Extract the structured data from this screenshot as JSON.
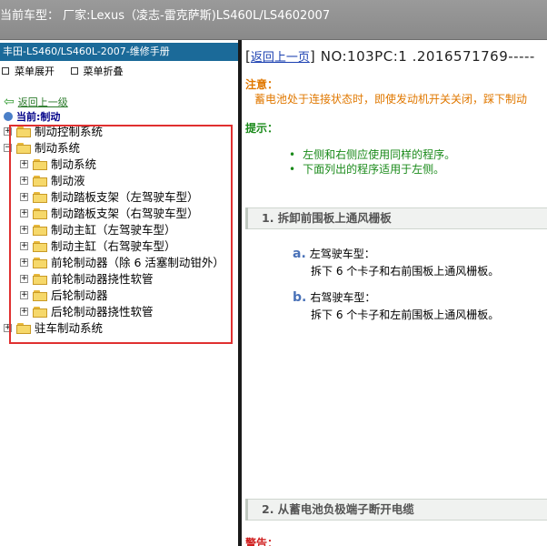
{
  "window": {
    "title": "当前车型： 厂家:Lexus（凌志-雷克萨斯)LS460L/LS4602007"
  },
  "left_panel": {
    "header": "丰田-LS460/LS460L-2007-维修手册",
    "menu_expand": "菜单展开",
    "menu_collapse": "菜单折叠",
    "back_link": "返回上一级",
    "current_label": "当前:制动",
    "tree": [
      {
        "label": "制动控制系统",
        "level": 0,
        "expander": "+"
      },
      {
        "label": "制动系统",
        "level": 0,
        "expander": "−"
      },
      {
        "label": "制动系统",
        "level": 1,
        "expander": "+"
      },
      {
        "label": "制动液",
        "level": 1,
        "expander": "+"
      },
      {
        "label": "制动踏板支架（左驾驶车型）",
        "level": 1,
        "expander": "+"
      },
      {
        "label": "制动踏板支架（右驾驶车型）",
        "level": 1,
        "expander": "+"
      },
      {
        "label": "制动主缸（左驾驶车型）",
        "level": 1,
        "expander": "+"
      },
      {
        "label": "制动主缸（右驾驶车型）",
        "level": 1,
        "expander": "+"
      },
      {
        "label": "前轮制动器（除 6 活塞制动钳外）",
        "level": 1,
        "expander": "+"
      },
      {
        "label": "前轮制动器挠性软管",
        "level": 1,
        "expander": "+"
      },
      {
        "label": "后轮制动器",
        "level": 1,
        "expander": "+"
      },
      {
        "label": "后轮制动器挠性软管",
        "level": 1,
        "expander": "+"
      },
      {
        "label": "驻车制动系统",
        "level": 0,
        "expander": "+"
      }
    ]
  },
  "right_panel": {
    "back_link": "返回上一页",
    "doc_no": "NO:103PC:1 .2016571769-----",
    "note_heading": "注意：",
    "note_text": "蓄电池处于连接状态时，即使发动机开关关闭，踩下制动",
    "tip_heading": "提示：",
    "tips": [
      "左侧和右侧应使用同样的程序。",
      "下面列出的程序适用于左侧。"
    ],
    "step1": "1. 拆卸前围板上通风栅板",
    "substeps": [
      {
        "letter": "a.",
        "title": "左驾驶车型：",
        "text": "拆下 6 个卡子和右前围板上通风栅板。"
      },
      {
        "letter": "b.",
        "title": "右驾驶车型：",
        "text": "拆下 6 个卡子和左前围板上通风栅板。"
      }
    ],
    "step2": "2. 从蓄电池负极端子断开电缆",
    "warning_heading": "警告："
  },
  "colors": {
    "left_header_bg": "#1b6a99",
    "highlight_box": "#e03030",
    "note": "#e07800",
    "tip": "#1a8a1a",
    "warning": "#d02020"
  }
}
